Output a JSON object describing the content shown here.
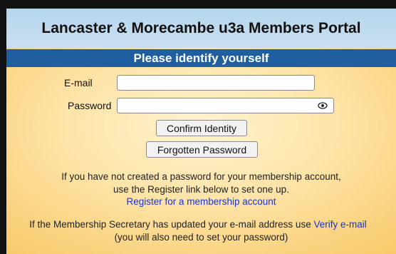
{
  "header": {
    "title": "Lancaster & Morecambe u3a Members Portal"
  },
  "banner": {
    "title": "Please identify yourself"
  },
  "form": {
    "email_label": "E-mail",
    "email_value": "",
    "password_label": "Password",
    "password_value": "",
    "confirm_button": "Confirm Identity",
    "forgotten_button": "Forgotten Password"
  },
  "info": {
    "line1": "If you have not created a password for your membership account,",
    "line2": "use the Register link below to set one up.",
    "register_link": "Register for a membership account",
    "line3_prefix": "If the Membership Secretary has updated your e-mail address use ",
    "verify_link": "Verify e-mail",
    "line4": "(you will also need to set your password)"
  },
  "icons": {
    "password_toggle": "eye-icon"
  },
  "colors": {
    "banner": "#1f5fa0",
    "header": "#b6d6ee",
    "link": "#1a33cc"
  }
}
